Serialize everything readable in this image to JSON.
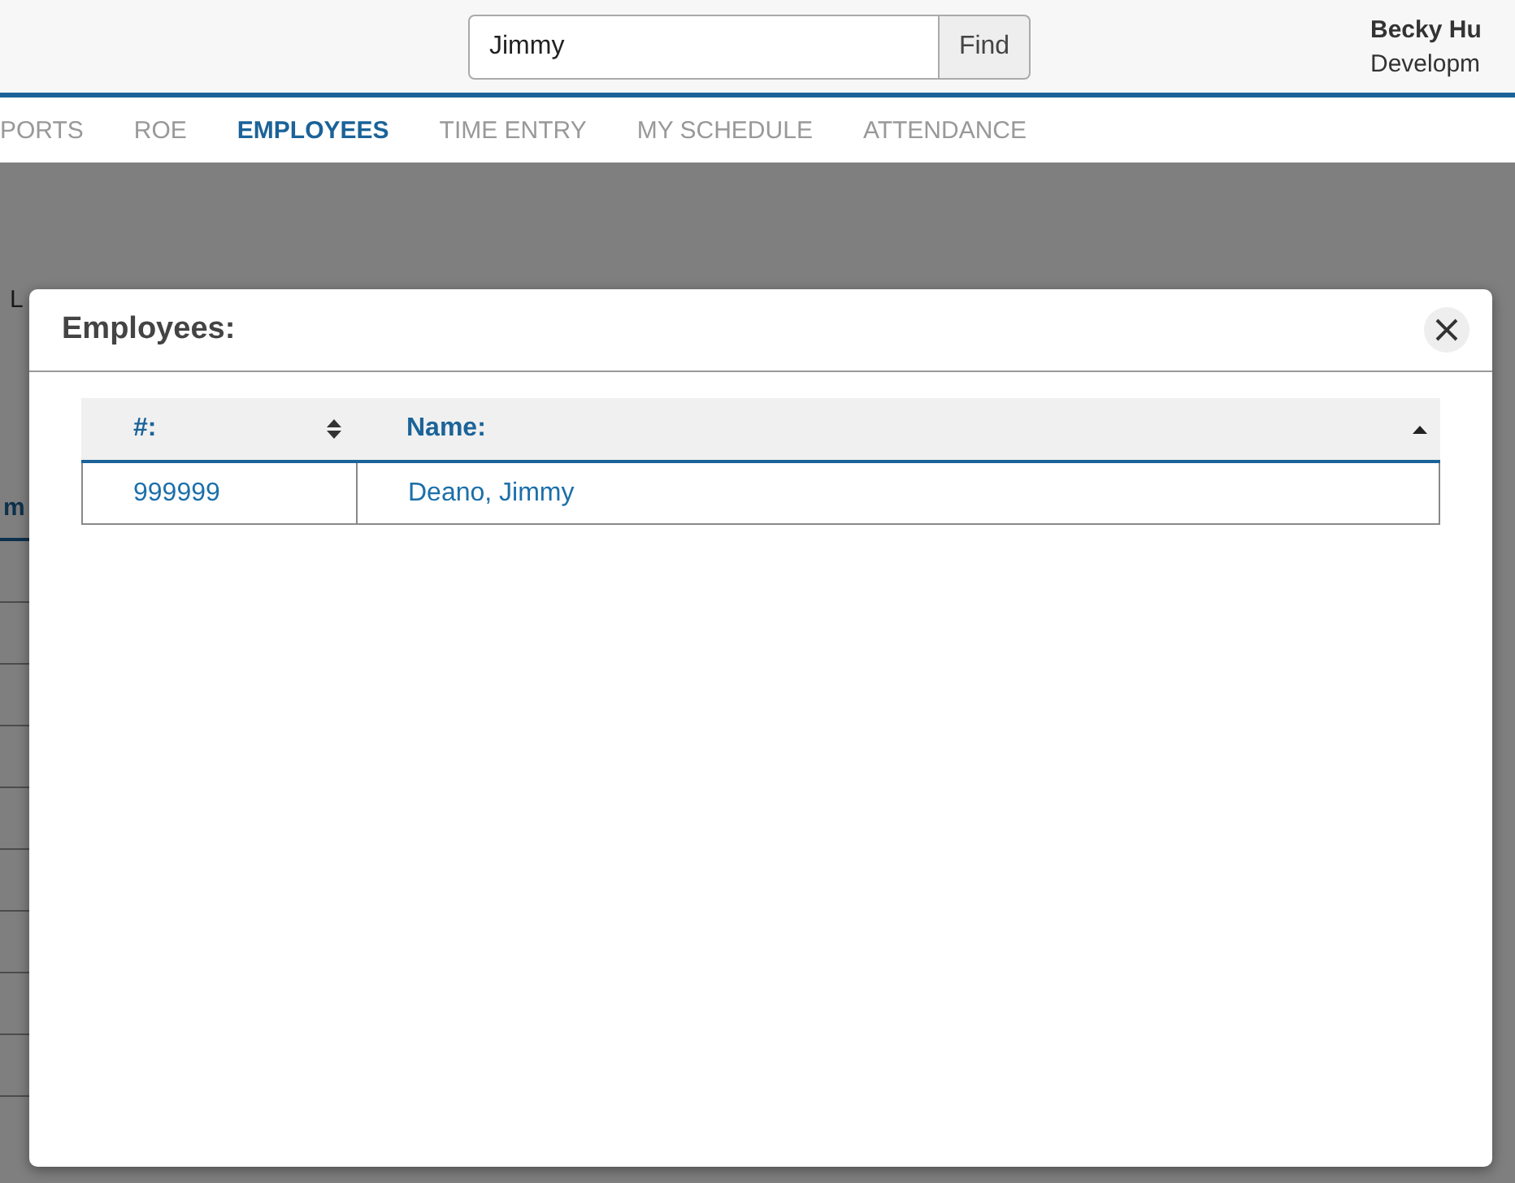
{
  "search": {
    "value": "Jimmy",
    "button": "Find"
  },
  "user": {
    "name": "Becky Hu",
    "role": "Developm"
  },
  "nav": [
    {
      "label": "PORTS",
      "selected": false
    },
    {
      "label": "ROE",
      "selected": false
    },
    {
      "label": "EMPLOYEES",
      "selected": true
    },
    {
      "label": "TIME ENTRY",
      "selected": false
    },
    {
      "label": "MY SCHEDULE",
      "selected": false
    },
    {
      "label": "ATTENDANCE",
      "selected": false
    }
  ],
  "page": {
    "label_fragment": "L",
    "column_fragment": "m"
  },
  "dialog": {
    "title": "Employees:",
    "table": {
      "columns": [
        {
          "label": "#:",
          "sorted": false
        },
        {
          "label": "Name:",
          "sorted": true
        }
      ],
      "rows": [
        [
          "999999",
          "Deano, Jimmy"
        ]
      ]
    }
  }
}
